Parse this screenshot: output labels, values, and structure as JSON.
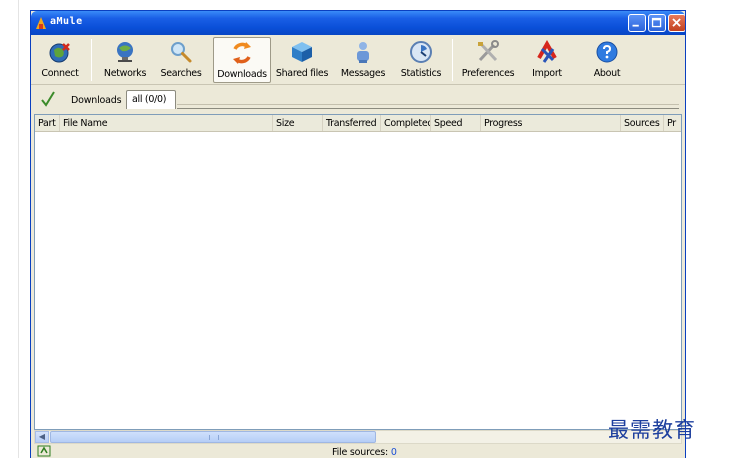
{
  "window": {
    "title": "aMule"
  },
  "toolbar": {
    "items": [
      {
        "label": "Connect",
        "icon": "connect-icon"
      },
      {
        "label": "Networks",
        "icon": "networks-icon"
      },
      {
        "label": "Searches",
        "icon": "searches-icon"
      },
      {
        "label": "Downloads",
        "icon": "downloads-icon",
        "active": true
      },
      {
        "label": "Shared files",
        "icon": "shared-files-icon"
      },
      {
        "label": "Messages",
        "icon": "messages-icon"
      },
      {
        "label": "Statistics",
        "icon": "statistics-icon"
      },
      {
        "label": "Preferences",
        "icon": "preferences-icon"
      },
      {
        "label": "Import",
        "icon": "import-icon"
      },
      {
        "label": "About",
        "icon": "about-icon"
      }
    ]
  },
  "tabs": {
    "section_label": "Downloads",
    "active_tab": "all (0/0)"
  },
  "list": {
    "columns": [
      "Part",
      "File Name",
      "Size",
      "Transferred",
      "Completed",
      "Speed",
      "Progress",
      "Sources",
      "Pr"
    ],
    "rows": []
  },
  "status": {
    "label": "File sources: ",
    "value": "0"
  },
  "watermark": {
    "text": "最需教育"
  },
  "colors": {
    "titlebar": "#0a4fd8",
    "window_bg": "#ece9d8",
    "accent_link": "#1b4fd6"
  }
}
